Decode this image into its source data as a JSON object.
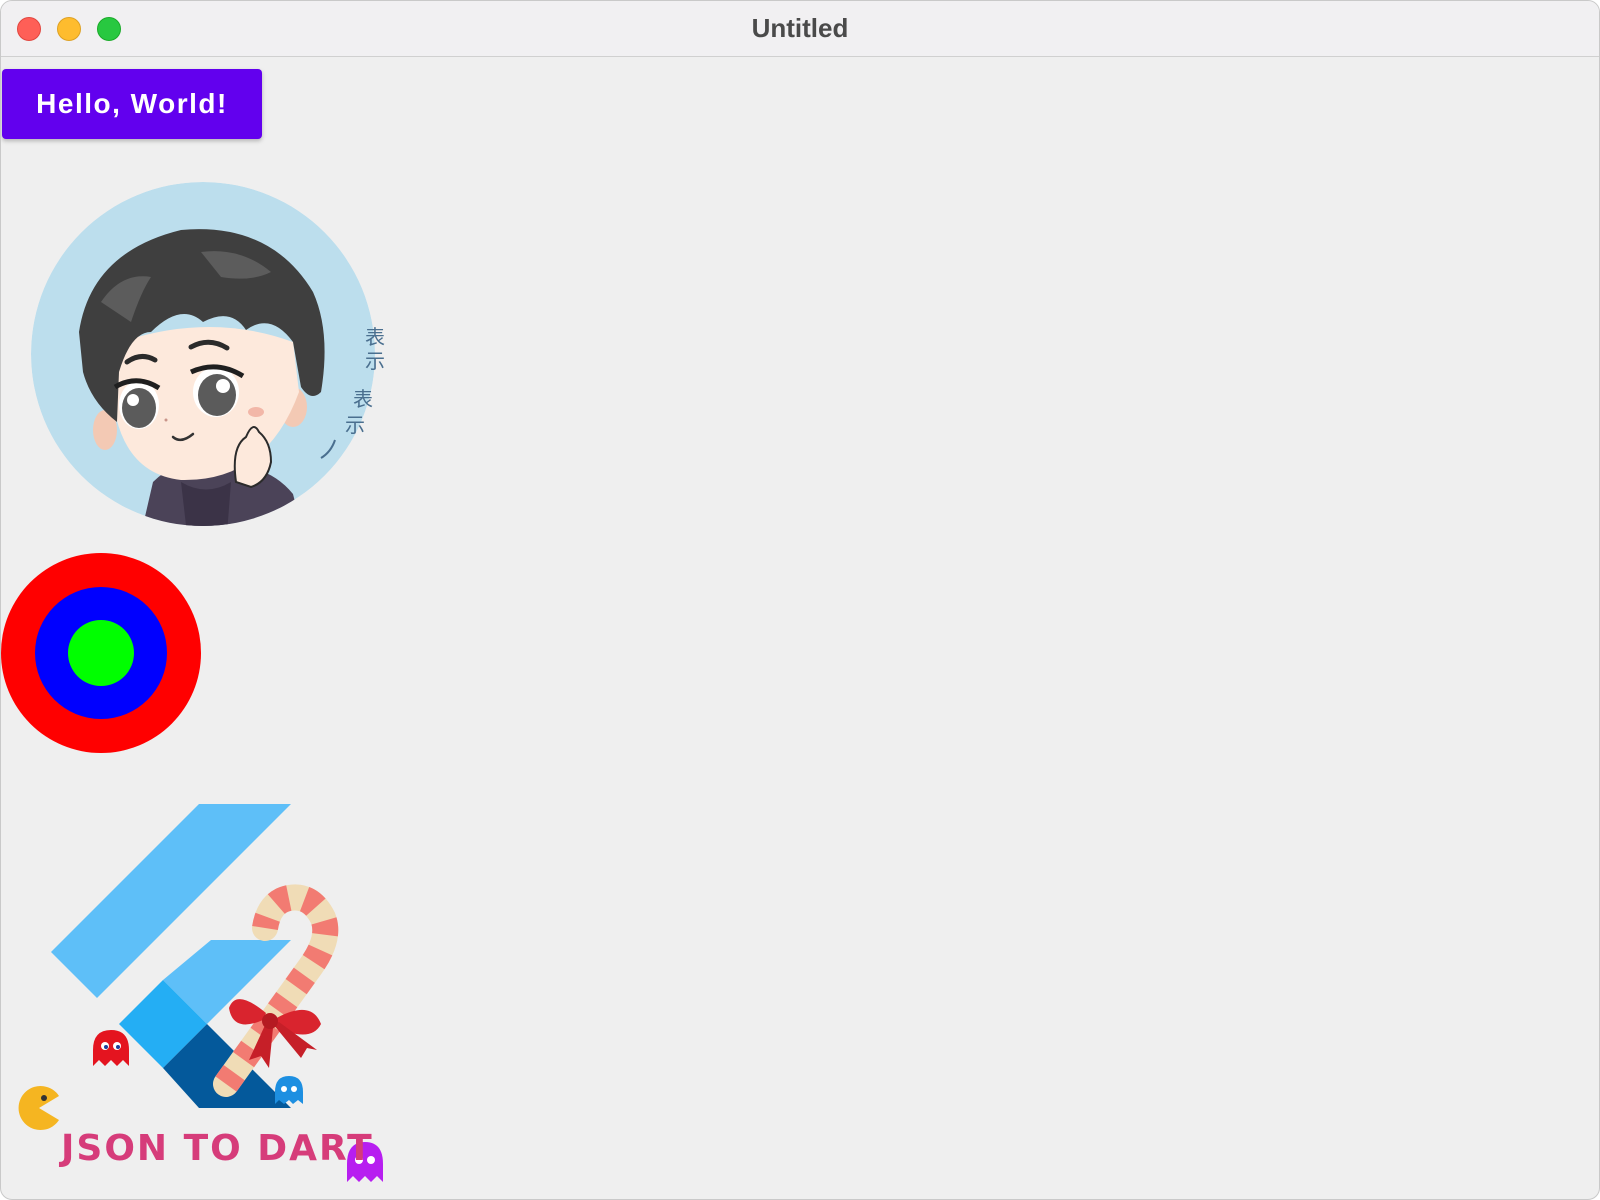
{
  "window": {
    "title": "Untitled",
    "controls": {
      "close": "close-control",
      "minimize": "minimize-control",
      "zoom": "zoom-control"
    }
  },
  "main": {
    "button_label": "Hello, World!",
    "avatar": {
      "caption": "表示 表示~",
      "background_color": "#bcdeed"
    },
    "target": {
      "colors": [
        "#ff0000",
        "#0000ff",
        "#00ff00"
      ]
    },
    "logo": {
      "text": "JSON TO DART"
    }
  },
  "colors": {
    "button": "#6200ee",
    "window_bg": "#efefef",
    "logo_text": "#d63c7a"
  }
}
